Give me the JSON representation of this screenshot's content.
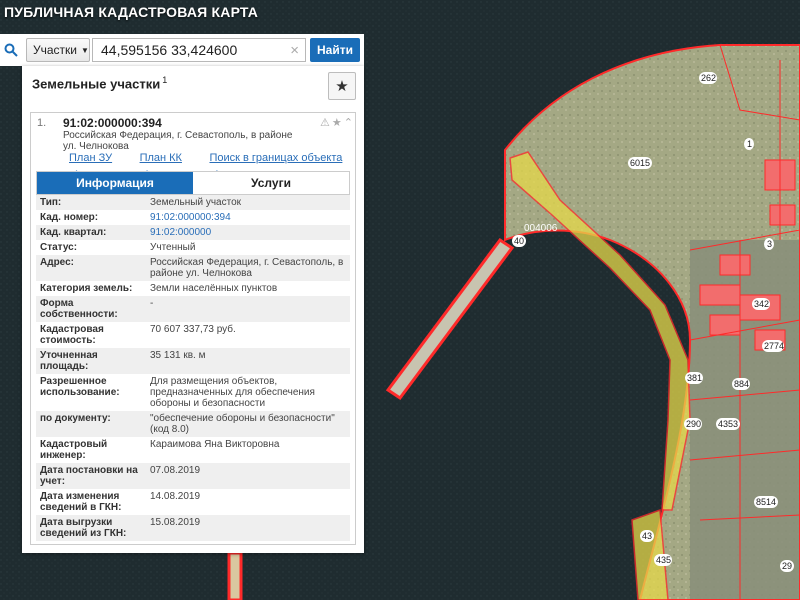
{
  "app": {
    "title": "ПУБЛИЧНАЯ КАДАСТРОВАЯ КАРТА"
  },
  "search": {
    "type_label": "Участки",
    "value": "44,595156 33,424600",
    "button_label": "Найти"
  },
  "panel": {
    "title": "Земельные участки",
    "count": "1"
  },
  "card": {
    "index": "1.",
    "cad_number": "91:02:000000:394",
    "address": "Российская Федерация, г. Севастополь, в районе ул. Челнокова",
    "links": [
      "План ЗУ →",
      "План КК →",
      "Поиск в границах объекта →"
    ],
    "tabs": [
      "Информация",
      "Услуги"
    ]
  },
  "info_rows": [
    {
      "label": "Тип:",
      "value": "Земельный участок"
    },
    {
      "label": "Кад. номер:",
      "value": "91:02:000000:394"
    },
    {
      "label": "Кад. квартал:",
      "value": "91:02:000000"
    },
    {
      "label": "Статус:",
      "value": "Учтенный"
    },
    {
      "label": "Адрес:",
      "value": "Российская Федерация, г. Севастополь, в районе ул. Челнокова"
    },
    {
      "label": "Категория земель:",
      "value": "Земли населённых пунктов"
    },
    {
      "label": "Форма собственности:",
      "value": "-"
    },
    {
      "label": "Кадастровая стоимость:",
      "value": "70 607 337,73 руб."
    },
    {
      "label": "Уточненная площадь:",
      "value": "35 131 кв. м"
    },
    {
      "label": "Разрешенное использование:",
      "value": "Для размещения объектов, предназначенных для обеспечения обороны и безопасности"
    },
    {
      "label": "по документу:",
      "value": "\"обеспечение обороны и безопасности\" (код 8.0)"
    },
    {
      "label": "Кадастровый инженер:",
      "value": "Караимова Яна Викторовна"
    },
    {
      "label": "Дата постановки на учет:",
      "value": "07.08.2019"
    },
    {
      "label": "Дата изменения сведений в ГКН:",
      "value": "14.08.2019"
    },
    {
      "label": "Дата выгрузки сведений из ГКН:",
      "value": "15.08.2019"
    }
  ],
  "map_labels": [
    "262",
    "6015",
    "1",
    "004006",
    "40",
    "3",
    "342",
    "2774",
    "381",
    "884",
    "290",
    "4353",
    "8514",
    "43",
    "435",
    "29"
  ],
  "colors": {
    "accent": "#1a6db8",
    "parcel_border": "#ff2a2a",
    "selected_fill": "#e6d94a",
    "water": "#1e2a2e",
    "land": "#9aa07e"
  }
}
